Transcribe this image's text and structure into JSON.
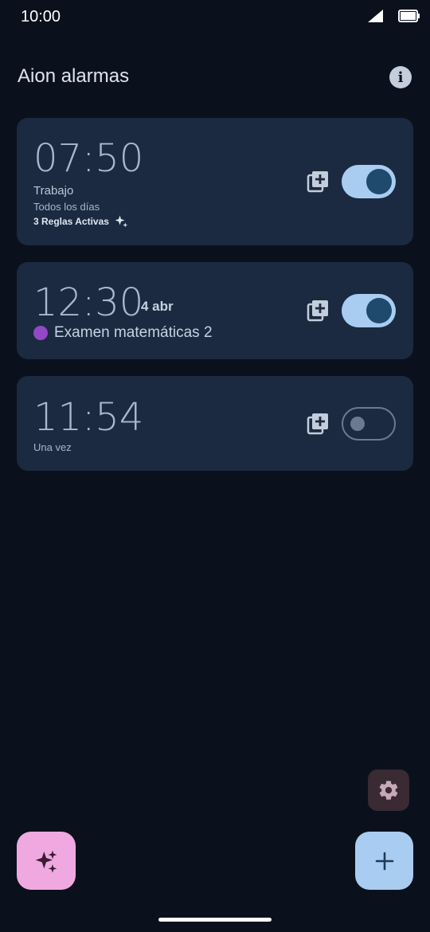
{
  "status_bar": {
    "time": "10:00",
    "icons": [
      "signal-icon",
      "battery-icon"
    ]
  },
  "header": {
    "title": "Aion alarmas",
    "info_icon": "info-icon"
  },
  "alarms": [
    {
      "time": "07:50",
      "label": "Trabajo",
      "repeat": "Todos los días",
      "rules": "3 Reglas Activas",
      "enabled": true
    },
    {
      "time": "12:30",
      "date": "4 abr",
      "event": "Examen matemáticas 2",
      "enabled": true
    },
    {
      "time": "11:54",
      "repeat": "Una vez",
      "enabled": false
    }
  ],
  "colors": {
    "background": "#0b111c",
    "card": "#1b2a41",
    "toggle_on": "#a8cdf0",
    "fab_magic": "#f0a9e0",
    "fab_add": "#a8cdf0",
    "event_dot": "#9348c7"
  },
  "buttons": {
    "settings_icon": "gear-icon",
    "magic_icon": "sparkles-icon",
    "add_icon": "plus-icon"
  }
}
